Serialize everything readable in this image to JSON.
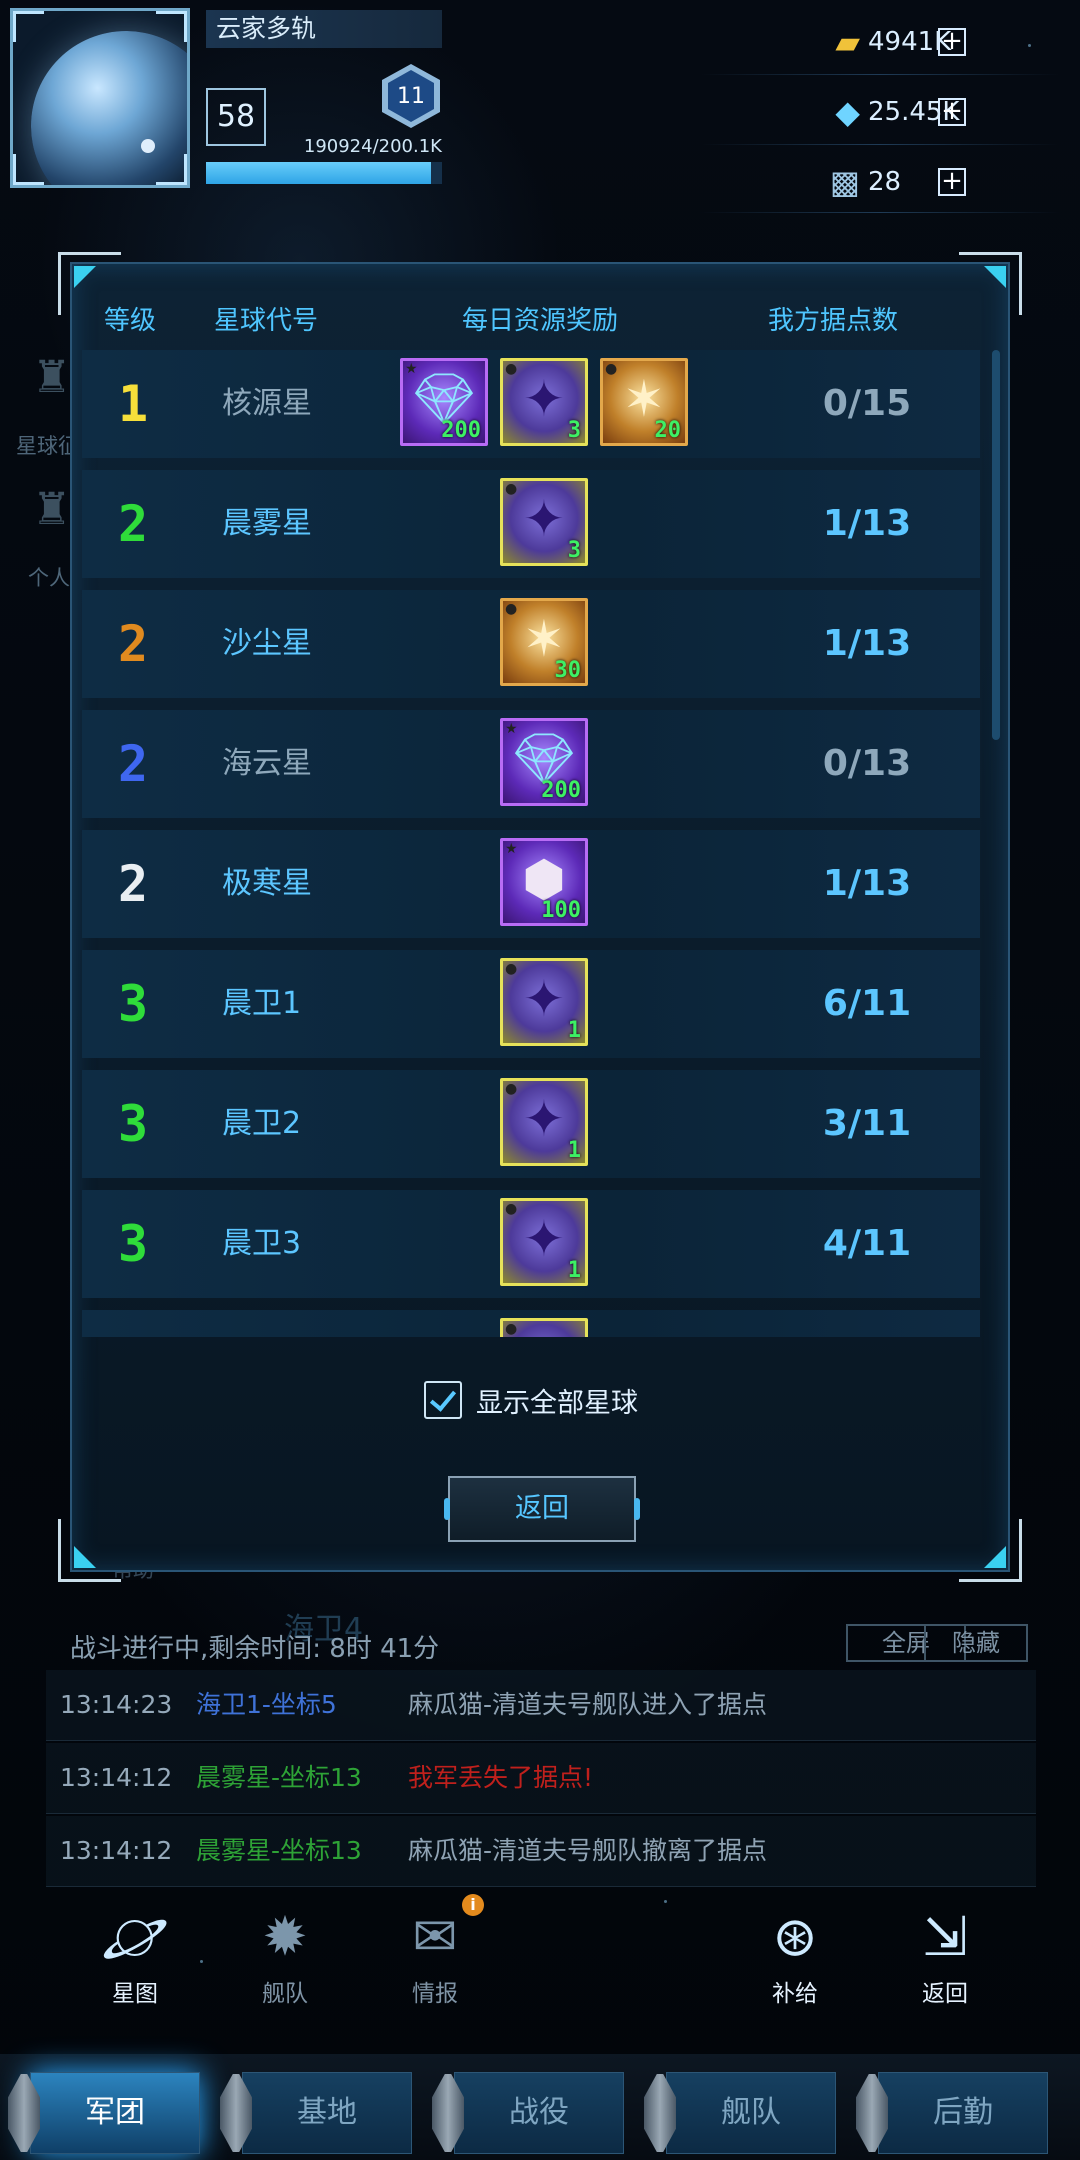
{
  "player": {
    "name": "云家多轨",
    "level": "58",
    "rank": "11",
    "exp_text": "190924/200.1K",
    "exp_progress": 0.954
  },
  "resources": [
    {
      "icon": "gold-bar-icon",
      "value": "4941K"
    },
    {
      "icon": "diamond-icon",
      "value": "25.45K"
    },
    {
      "icon": "supply-crate-icon",
      "value": "28"
    }
  ],
  "background_labels": {
    "planet_reward": "星球征战",
    "personal": "个人",
    "help": "帮助",
    "hai_wei_4": "海卫4"
  },
  "dialog": {
    "headers": {
      "level": "等级",
      "code": "星球代号",
      "reward": "每日资源奖励",
      "strongholds": "我方据点数"
    },
    "rows": [
      {
        "level": "1",
        "level_color": "#f6df3a",
        "name": "核源星",
        "name_color": "#8ea8bb",
        "score": "0/15",
        "score_color": "#8ea8bb",
        "rewards": [
          {
            "kind": "purple",
            "icon": "diamond-icon",
            "qty": "200"
          },
          {
            "kind": "yellow",
            "icon": "crystal-icon",
            "qty": "3"
          },
          {
            "kind": "gold",
            "icon": "star-crystal-icon",
            "qty": "20"
          }
        ]
      },
      {
        "level": "2",
        "level_color": "#2fdc3a",
        "name": "晨雾星",
        "name_color": "#5cc6ff",
        "score": "1/13",
        "score_color": "#5cc6ff",
        "rewards": [
          {
            "kind": "yellow",
            "icon": "crystal-icon",
            "qty": "3"
          }
        ]
      },
      {
        "level": "2",
        "level_color": "#e08a1f",
        "name": "沙尘星",
        "name_color": "#5cc6ff",
        "score": "1/13",
        "score_color": "#5cc6ff",
        "rewards": [
          {
            "kind": "gold",
            "icon": "star-crystal-icon",
            "qty": "30"
          }
        ]
      },
      {
        "level": "2",
        "level_color": "#3f67f0",
        "name": "海云星",
        "name_color": "#8ea8bb",
        "score": "0/13",
        "score_color": "#8ea8bb",
        "rewards": [
          {
            "kind": "purple",
            "icon": "diamond-icon",
            "qty": "200"
          }
        ]
      },
      {
        "level": "2",
        "level_color": "#e9eef2",
        "name": "极寒星",
        "name_color": "#5cc6ff",
        "score": "1/13",
        "score_color": "#5cc6ff",
        "rewards": [
          {
            "kind": "purple",
            "icon": "ore-icon",
            "qty": "100"
          }
        ]
      },
      {
        "level": "3",
        "level_color": "#2fdc3a",
        "name": "晨卫1",
        "name_color": "#5cc6ff",
        "score": "6/11",
        "score_color": "#5cc6ff",
        "rewards": [
          {
            "kind": "yellow",
            "icon": "crystal-icon",
            "qty": "1"
          }
        ]
      },
      {
        "level": "3",
        "level_color": "#2fdc3a",
        "name": "晨卫2",
        "name_color": "#5cc6ff",
        "score": "3/11",
        "score_color": "#5cc6ff",
        "rewards": [
          {
            "kind": "yellow",
            "icon": "crystal-icon",
            "qty": "1"
          }
        ]
      },
      {
        "level": "3",
        "level_color": "#2fdc3a",
        "name": "晨卫3",
        "name_color": "#5cc6ff",
        "score": "4/11",
        "score_color": "#5cc6ff",
        "rewards": [
          {
            "kind": "yellow",
            "icon": "crystal-icon",
            "qty": "1"
          }
        ]
      },
      {
        "level": "",
        "level_color": "#2fdc3a",
        "name": "",
        "name_color": "#5cc6ff",
        "score": "",
        "score_color": "#5cc6ff",
        "rewards": [
          {
            "kind": "yellow",
            "icon": "crystal-icon",
            "qty": ""
          }
        ]
      }
    ],
    "show_all_label": "显示全部星球",
    "show_all_checked": true,
    "return_label": "返回"
  },
  "log": {
    "title": "战斗进行中,剩余时间: 8时 41分",
    "fullscreen_label": "全屏",
    "hide_label": "隐藏",
    "entries": [
      {
        "time": "13:14:23",
        "location": "海卫1-坐标5",
        "location_color": "#3f72d8",
        "message": "麻瓜猫-清道夫号舰队进入了据点",
        "message_color": "#8fa3b4"
      },
      {
        "time": "13:14:12",
        "location": "晨雾星-坐标13",
        "location_color": "#2ea336",
        "message": "我军丢失了据点!",
        "message_color": "#c0201c"
      },
      {
        "time": "13:14:12",
        "location": "晨雾星-坐标13",
        "location_color": "#2ea336",
        "message": "麻瓜猫-清道夫号舰队撤离了据点",
        "message_color": "#8fa3b4"
      }
    ]
  },
  "nav": {
    "star_map": "星图",
    "fleet": "舰队",
    "intel": "情报",
    "supply": "补给",
    "back": "返回"
  },
  "tabs": {
    "items": [
      "军团",
      "基地",
      "战役",
      "舰队",
      "后勤"
    ],
    "active_index": 0
  }
}
